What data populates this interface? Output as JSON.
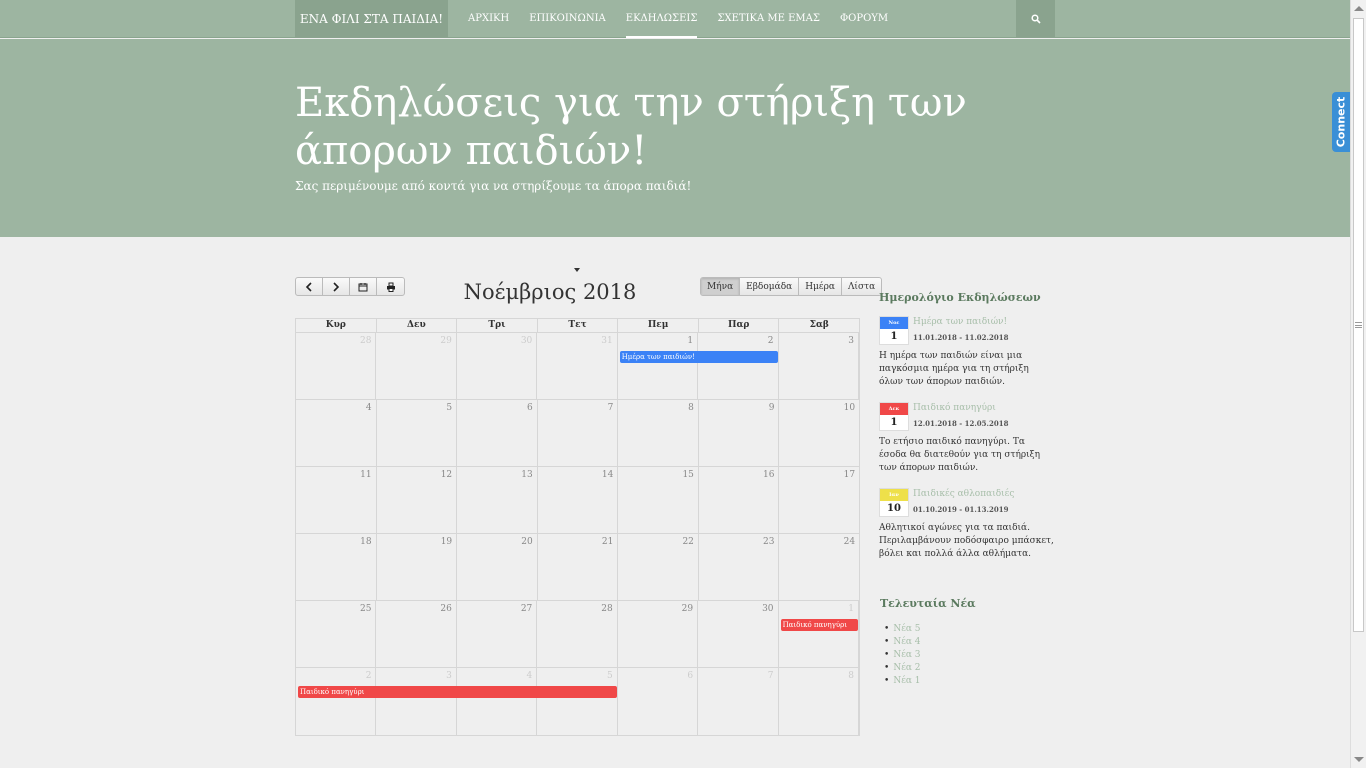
{
  "brand": "ΕΝΑ ΦΙΛΙ ΣΤΑ ΠΑΙΔΙΑ!",
  "nav": [
    "ΑΡΧΙΚΗ",
    "ΕΠΙΚΟΙΝΩΝΙΑ",
    "ΕΚΔΗΛΩΣΕΙΣ",
    "ΣΧΕΤΙΚΑ ΜΕ ΕΜΑΣ",
    "ΦΟΡΟΥΜ"
  ],
  "nav_active": "ΕΚΔΗΛΩΣΕΙΣ",
  "hero": {
    "title": "Εκδηλώσεις για την στήριξη των άπορων παιδιών!",
    "subtitle": "Σας περιμένουμε από κοντά για να στηρίξουμε τα άπορα παιδιά!"
  },
  "connect": "Connect",
  "calendar": {
    "title": "Νοέμβριος 2018",
    "views": [
      "Μήνα",
      "Εβδομάδα",
      "Ημέρα",
      "Λίστα"
    ],
    "active_view": "Μήνα",
    "weekdays": [
      "Κυρ",
      "Δευ",
      "Τρι",
      "Τετ",
      "Πεμ",
      "Παρ",
      "Σαβ"
    ],
    "weeks": [
      [
        {
          "d": "28",
          "o": true
        },
        {
          "d": "29",
          "o": true
        },
        {
          "d": "30",
          "o": true
        },
        {
          "d": "31",
          "o": true
        },
        {
          "d": "1"
        },
        {
          "d": "2"
        },
        {
          "d": "3"
        }
      ],
      [
        {
          "d": "4"
        },
        {
          "d": "5"
        },
        {
          "d": "6"
        },
        {
          "d": "7"
        },
        {
          "d": "8"
        },
        {
          "d": "9"
        },
        {
          "d": "10"
        }
      ],
      [
        {
          "d": "11"
        },
        {
          "d": "12"
        },
        {
          "d": "13"
        },
        {
          "d": "14"
        },
        {
          "d": "15"
        },
        {
          "d": "16"
        },
        {
          "d": "17"
        }
      ],
      [
        {
          "d": "18"
        },
        {
          "d": "19"
        },
        {
          "d": "20"
        },
        {
          "d": "21"
        },
        {
          "d": "22"
        },
        {
          "d": "23"
        },
        {
          "d": "24"
        }
      ],
      [
        {
          "d": "25"
        },
        {
          "d": "26"
        },
        {
          "d": "27"
        },
        {
          "d": "28"
        },
        {
          "d": "29"
        },
        {
          "d": "30"
        },
        {
          "d": "1",
          "o": true
        }
      ],
      [
        {
          "d": "2",
          "o": true
        },
        {
          "d": "3",
          "o": true
        },
        {
          "d": "4",
          "o": true
        },
        {
          "d": "5",
          "o": true
        },
        {
          "d": "6",
          "o": true
        },
        {
          "d": "7",
          "o": true
        },
        {
          "d": "8",
          "o": true
        }
      ]
    ],
    "events": [
      {
        "label": "Ημέρα των παιδιών!",
        "week": 0,
        "start": 4,
        "span": 2,
        "color": "#3b82f6"
      },
      {
        "label": "Παιδικό πανηγύρι",
        "week": 4,
        "start": 6,
        "span": 1,
        "color": "#f04848"
      },
      {
        "label": "Παιδικό πανηγύρι",
        "week": 5,
        "start": 0,
        "span": 4,
        "color": "#f04848"
      }
    ]
  },
  "sidebar": {
    "events_title": "Ημερολόγιο Εκδηλώσεων",
    "events": [
      {
        "month": "Νοε",
        "day": "1",
        "color": "#3b82f6",
        "title": "Ημέρα των παιδιών!",
        "dates": "11.01.2018 - 11.02.2018",
        "desc": "Η ημέρα των παιδιών είναι μια παγκόσμια ημέρα για τη στήριξη όλων των άπορων παιδιών."
      },
      {
        "month": "Δεκ",
        "day": "1",
        "color": "#f04848",
        "title": "Παιδικό πανηγύρι",
        "dates": "12.01.2018 - 12.05.2018",
        "desc": "Το ετήσιο παιδικό πανηγύρι. Τα έσοδα θα διατεθούν για τη στήριξη των άπορων παιδιών."
      },
      {
        "month": "Ιαν",
        "day": "10",
        "color": "#eee04a",
        "title": "Παιδικές αθλοπαιδιές",
        "dates": "01.10.2019 - 01.13.2019",
        "desc": "Αθλητικοί αγώνες για τα παιδιά. Περιλαμβάνουν ποδόσφαιρο μπάσκετ, βόλει και πολλά άλλα αθλήματα."
      }
    ],
    "news_title": "Τελευταία Νέα",
    "news": [
      "Νέα 5",
      "Νέα 4",
      "Νέα 3",
      "Νέα 2",
      "Νέα 1"
    ]
  }
}
